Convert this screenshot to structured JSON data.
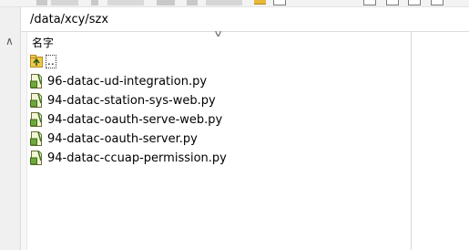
{
  "path": {
    "current": "/data/xcy/szx"
  },
  "columns": {
    "name_header": "名字"
  },
  "parent_dir": {
    "label": ".."
  },
  "files": [
    {
      "name": "96-datac-ud-integration.py",
      "icon": "python-file-icon"
    },
    {
      "name": "94-datac-station-sys-web.py",
      "icon": "python-file-icon"
    },
    {
      "name": "94-datac-oauth-serve-web.py",
      "icon": "python-file-icon"
    },
    {
      "name": "94-datac-oauth-server.py",
      "icon": "python-file-icon"
    },
    {
      "name": "94-datac-ccuap-permission.py",
      "icon": "python-file-icon"
    }
  ],
  "colors": {
    "folder_yellow": "#e8b93a",
    "py_green": "#6fa83a",
    "selection_border": "#333333"
  }
}
